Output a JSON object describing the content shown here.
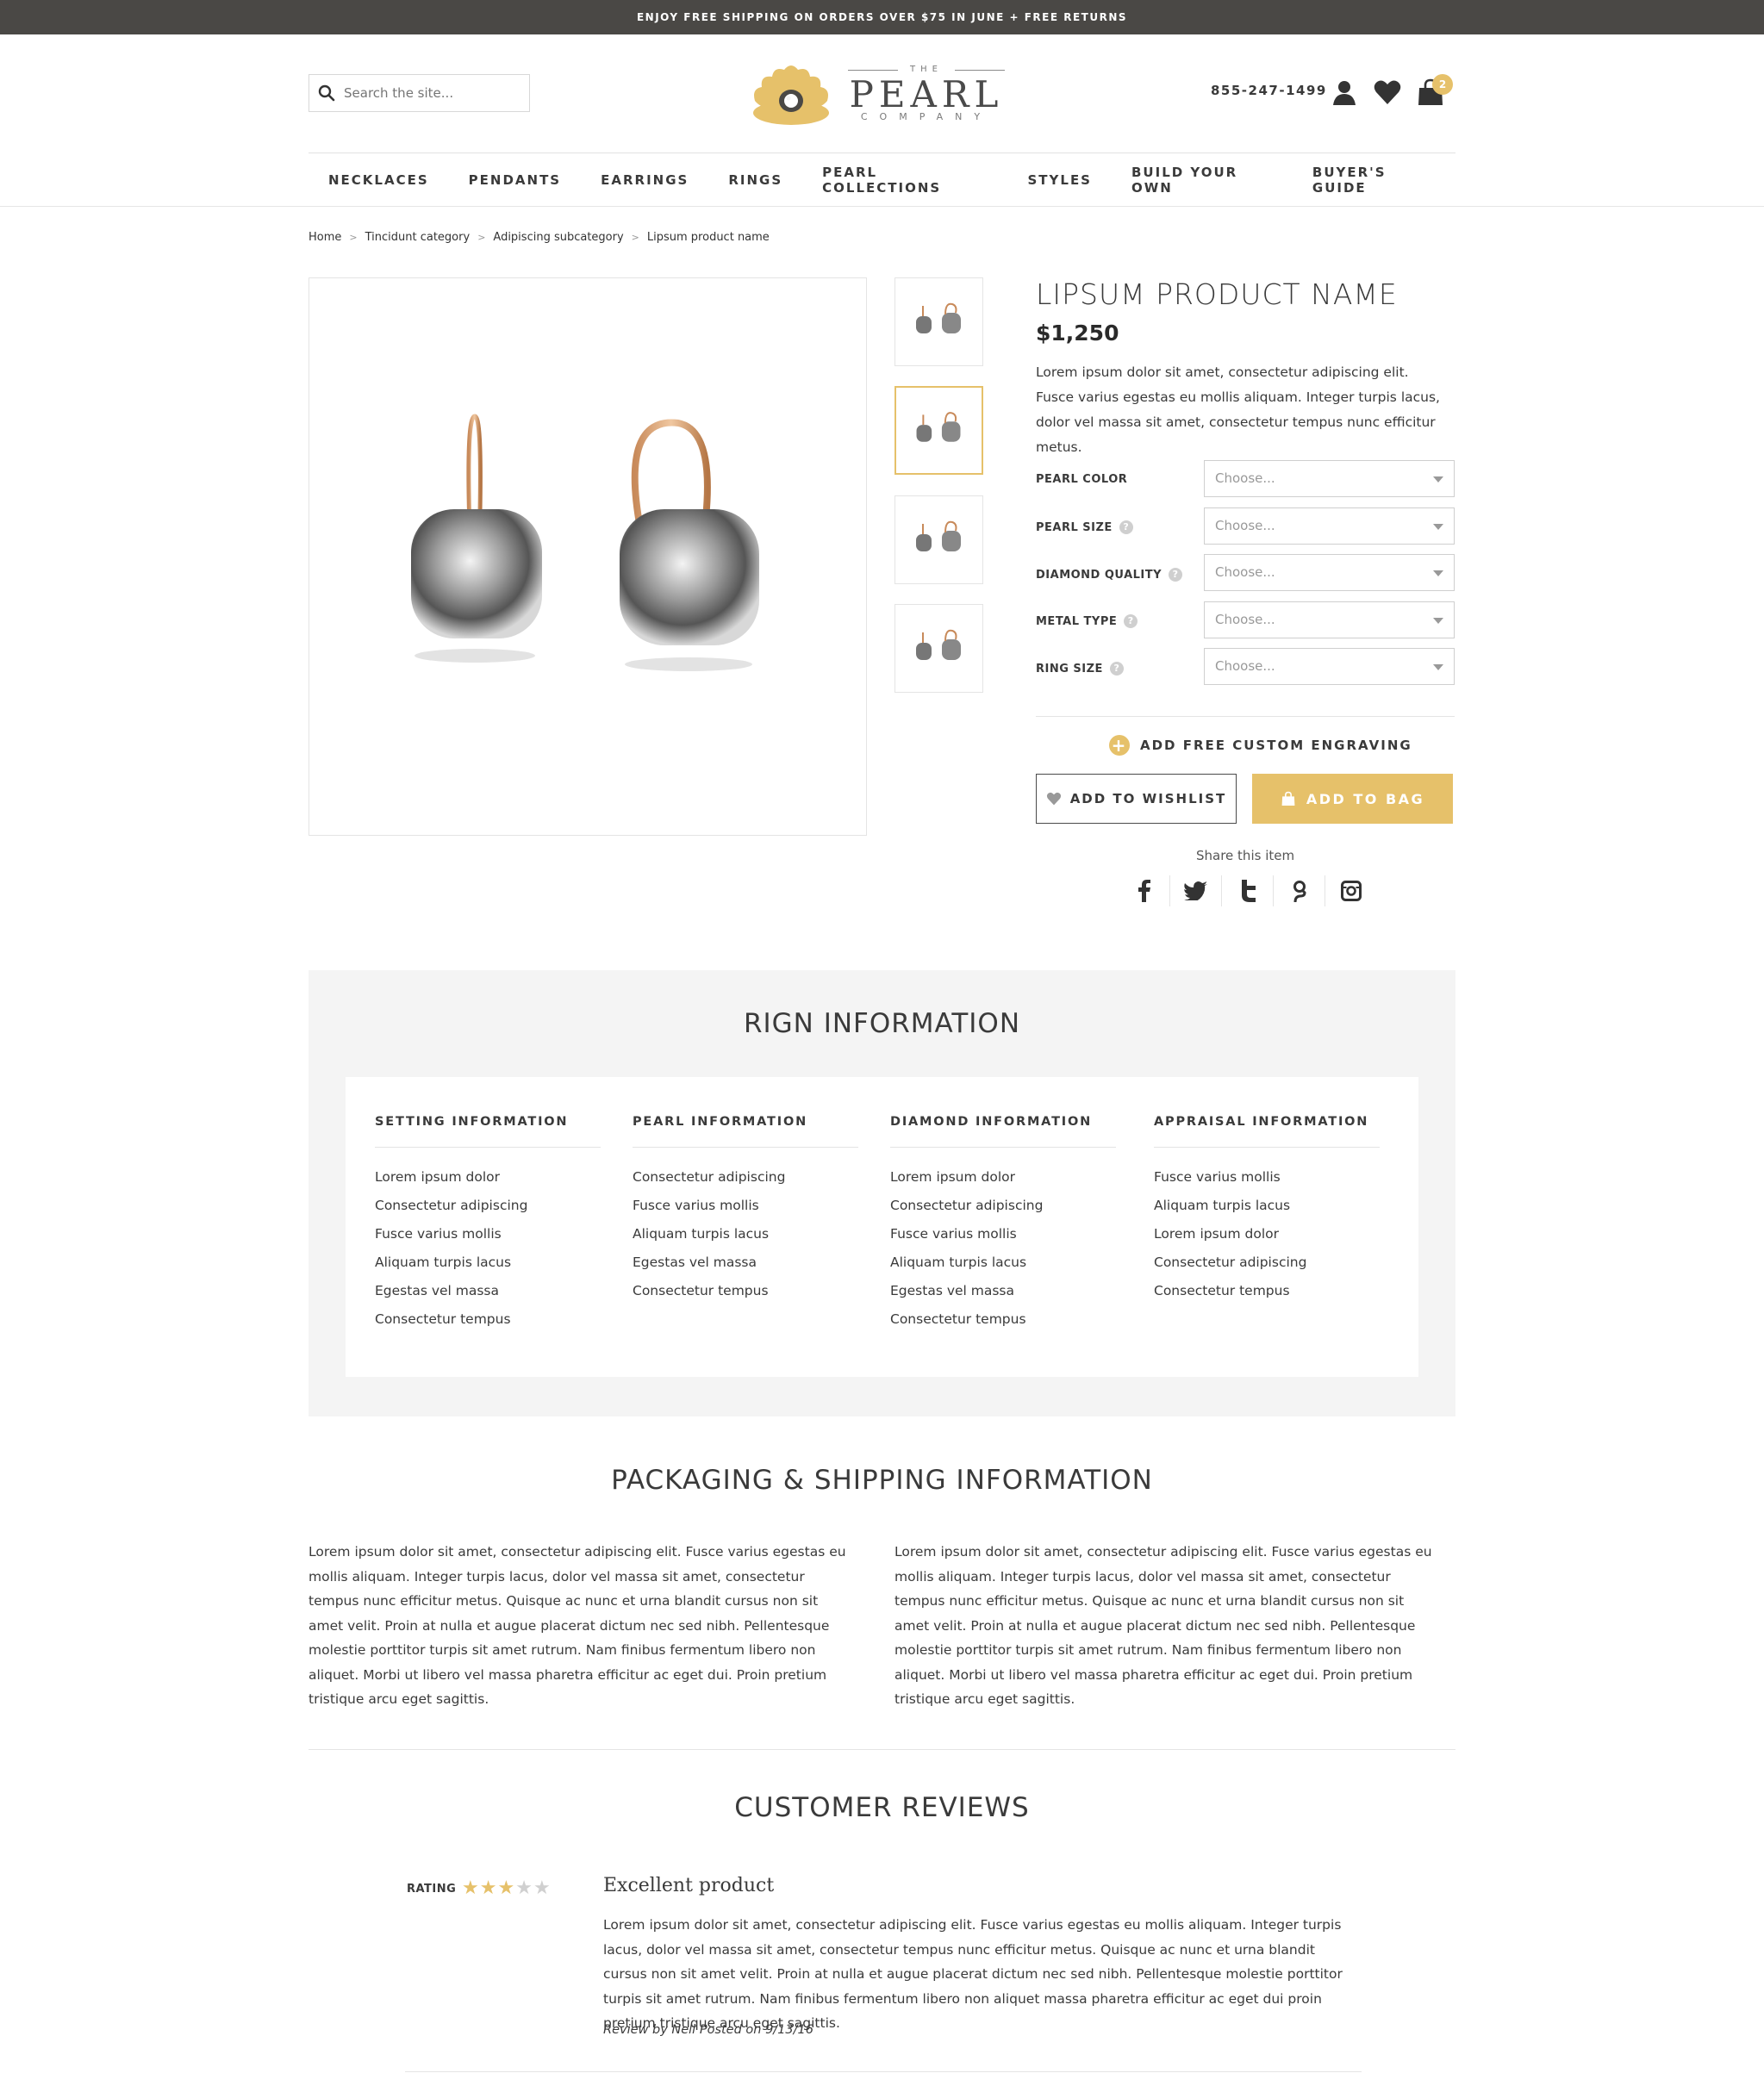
{
  "topbar": {
    "text": "ENJOY FREE SHIPPING ON ORDERS OVER $75 IN JUNE + FREE RETURNS"
  },
  "header": {
    "search_placeholder": "Search the site...",
    "logo": {
      "the": "THE",
      "pearl": "PEARL",
      "company": "COMPANY"
    },
    "phone": "855-247-1499",
    "cart_count": "2"
  },
  "nav": {
    "items": [
      "NECKLACES",
      "PENDANTS",
      "EARRINGS",
      "RINGS",
      "PEARL COLLECTIONS",
      "STYLES",
      "BUILD YOUR OWN",
      "BUYER'S GUIDE"
    ]
  },
  "breadcrumb": {
    "items": [
      "Home",
      "Tincidunt category",
      "Adipiscing subcategory",
      "Lipsum product name"
    ]
  },
  "product": {
    "title": "LIPSUM PRODUCT NAME",
    "price": "$1,250",
    "description": "Lorem ipsum dolor sit amet, consectetur adipiscing elit. Fusce varius egestas eu mollis aliquam. Integer turpis lacus, dolor vel massa sit amet, consectetur tempus nunc efficitur metus.",
    "options": [
      {
        "label": "PEARL COLOR",
        "value": "Choose..."
      },
      {
        "label": "PEARL SIZE",
        "value": "Choose..."
      },
      {
        "label": "DIAMOND QUALITY",
        "value": "Choose..."
      },
      {
        "label": "METAL TYPE",
        "value": "Choose..."
      },
      {
        "label": "RING SIZE",
        "value": "Choose..."
      }
    ],
    "engraving": "ADD FREE CUSTOM ENGRAVING",
    "wishlist_label": "ADD TO WISHLIST",
    "bag_label": "ADD TO BAG",
    "share_label": "Share this item"
  },
  "info": {
    "title": "RIGN INFORMATION",
    "columns": [
      {
        "heading": "SETTING INFORMATION",
        "items": [
          "Lorem ipsum dolor",
          "Consectetur adipiscing",
          "Fusce varius mollis",
          "Aliquam turpis lacus",
          "Egestas vel massa",
          "Consectetur tempus"
        ]
      },
      {
        "heading": "PEARL INFORMATION",
        "items": [
          "Consectetur adipiscing",
          "Fusce varius mollis",
          "Aliquam turpis lacus",
          "Egestas vel massa",
          "Consectetur tempus"
        ]
      },
      {
        "heading": "DIAMOND INFORMATION",
        "items": [
          "Lorem ipsum dolor",
          "Consectetur adipiscing",
          "Fusce varius mollis",
          "Aliquam turpis lacus",
          "Egestas vel massa",
          "Consectetur tempus"
        ]
      },
      {
        "heading": "APPRAISAL INFORMATION",
        "items": [
          "Fusce varius mollis",
          "Aliquam turpis lacus",
          "Lorem ipsum dolor",
          "Consectetur adipiscing",
          "Consectetur tempus"
        ]
      }
    ]
  },
  "packaging": {
    "title": "PACKAGING & SHIPPING INFORMATION",
    "left": "Lorem ipsum dolor sit amet, consectetur adipiscing elit. Fusce varius egestas eu mollis aliquam. Integer turpis lacus, dolor vel massa sit amet, consectetur tempus nunc efficitur metus. Quisque ac nunc et urna blandit cursus non sit amet velit. Proin at nulla et augue placerat dictum nec sed nibh. Pellentesque molestie porttitor turpis sit amet rutrum. Nam finibus fermentum libero non aliquet. Morbi ut libero vel massa pharetra efficitur ac eget dui. Proin pretium tristique arcu eget sagittis.",
    "right": "Lorem ipsum dolor sit amet, consectetur adipiscing elit. Fusce varius egestas eu mollis aliquam. Integer turpis lacus, dolor vel massa sit amet, consectetur tempus nunc efficitur metus. Quisque ac nunc et urna blandit cursus non sit amet velit. Proin at nulla et augue placerat dictum nec sed nibh. Pellentesque molestie porttitor turpis sit amet rutrum. Nam finibus fermentum libero non aliquet. Morbi ut libero vel massa pharetra efficitur ac eget dui. Proin pretium tristique arcu eget sagittis."
  },
  "reviews": {
    "title": "CUSTOMER REVIEWS",
    "rating_label": "RATING",
    "rating": 3,
    "rating_max": 5,
    "items": [
      {
        "headline": "Excellent product",
        "body": "Lorem ipsum dolor sit amet, consectetur adipiscing elit. Fusce varius egestas eu mollis aliquam. Integer turpis lacus, dolor vel massa sit amet, consectetur tempus nunc efficitur metus. Quisque ac nunc et urna blandit cursus non sit amet velit. Proin at nulla et augue placerat dictum nec sed nibh. Pellentesque molestie porttitor turpis sit amet rutrum. Nam finibus fermentum libero non aliquet massa pharetra efficitur ac eget dui proin pretium tristique arcu eget sagittis.",
        "byline": "Review by Nell Posted on 9/13/16"
      }
    ]
  },
  "colors": {
    "accent": "#e6c16a",
    "topbar": "#4a4845",
    "panel": "#f4f4f4",
    "text": "#3a3a3a"
  }
}
